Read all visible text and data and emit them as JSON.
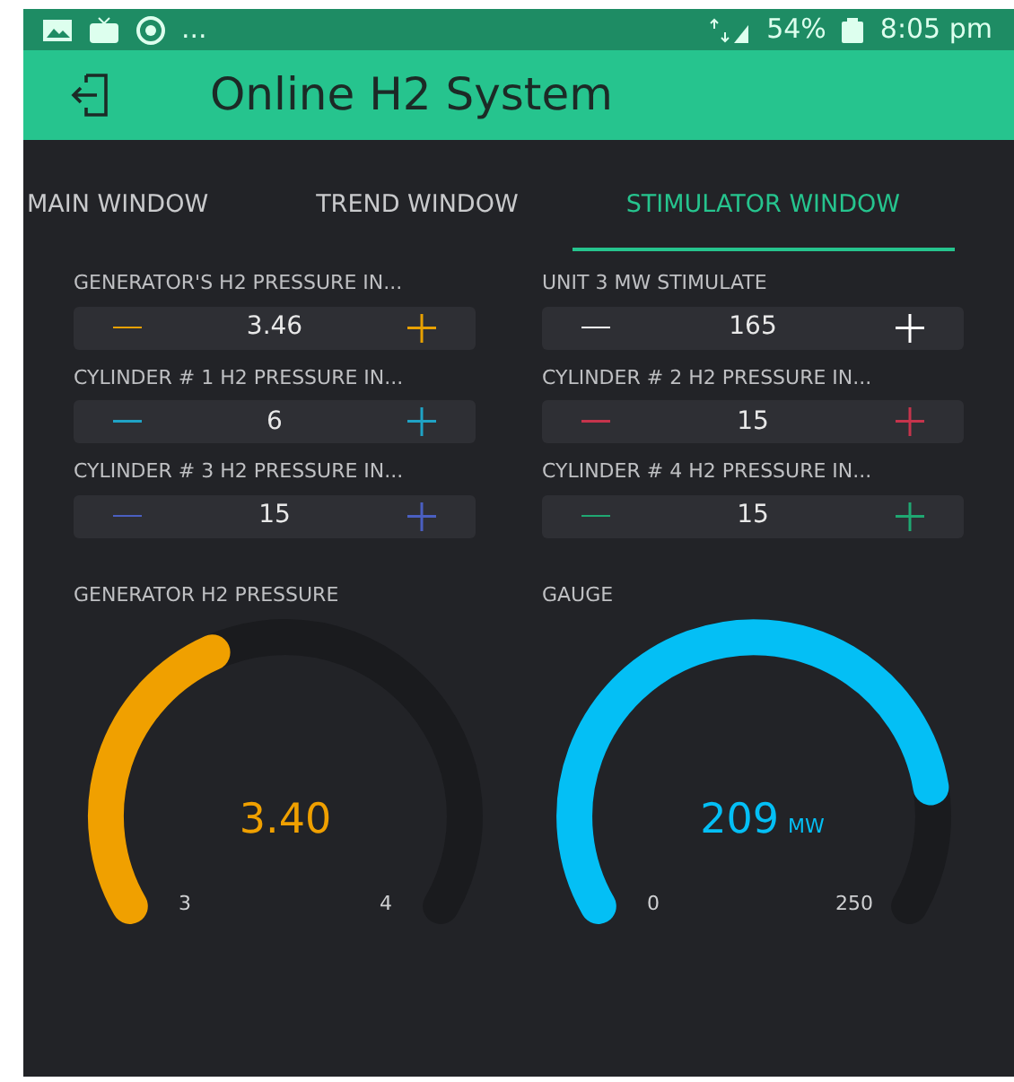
{
  "status_bar": {
    "more": "...",
    "battery": "54%",
    "time": "8:05 pm"
  },
  "app_bar": {
    "title": "Online H2 System"
  },
  "tabs": [
    {
      "label": "MAIN WINDOW",
      "selected": false
    },
    {
      "label": "TREND WINDOW",
      "selected": false
    },
    {
      "label": "STIMULATOR WINDOW",
      "selected": true
    }
  ],
  "steppers": [
    {
      "label": "GENERATOR'S  H2 PRESSURE IN...",
      "value": "3.46",
      "color": "#e8a100"
    },
    {
      "label": "UNIT 3 MW STIMULATE",
      "value": "165",
      "color": "#ffffff"
    },
    {
      "label": "CYLINDER # 1 H2 PRESSURE IN...",
      "value": "6",
      "color": "#1fa3c5"
    },
    {
      "label": "CYLINDER # 2 H2 PRESSURE IN...",
      "value": "15",
      "color": "#c6344c"
    },
    {
      "label": "CYLINDER # 3 H2 PRESSURE IN...",
      "value": "15",
      "color": "#4a5fc1"
    },
    {
      "label": "CYLINDER # 4 H2 PRESSURE IN...",
      "value": "15",
      "color": "#1fa872"
    }
  ],
  "gauges": [
    {
      "label": "GENERATOR H2 PRESSURE",
      "value": "3.40",
      "min": "3",
      "max": "4",
      "color": "#f0a000"
    },
    {
      "label": "GAUGE",
      "value": "209",
      "unit": "MW",
      "min": "0",
      "max": "250",
      "color": "#04bff5"
    }
  ]
}
